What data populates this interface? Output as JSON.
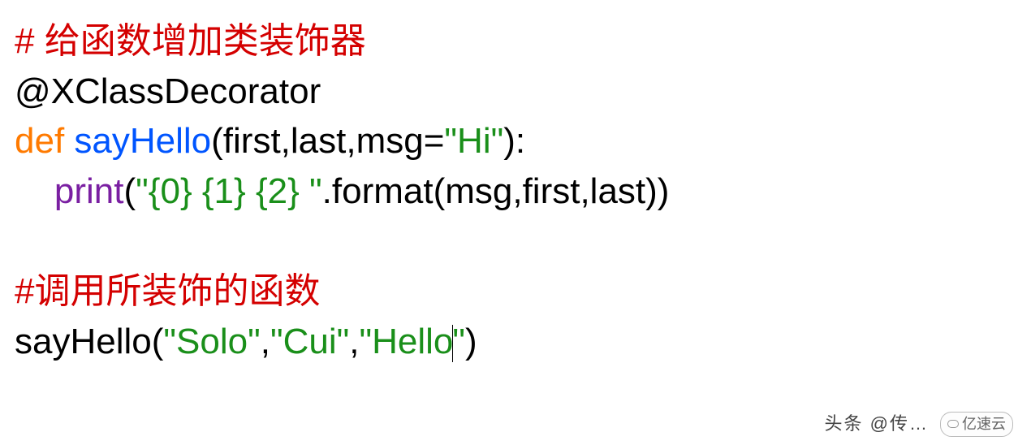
{
  "line1": {
    "comment": "# 给函数增加类装饰器"
  },
  "line2": {
    "decorator": "@XClassDecorator"
  },
  "line3": {
    "keyword": "def ",
    "func": "sayHello",
    "sig_open": "(first,last,msg=",
    "default_str": "\"Hi\"",
    "sig_close": "):"
  },
  "line4": {
    "indent": "    ",
    "print_name": "print",
    "open": "(",
    "fmt_str": "\"{0} {1} {2} \"",
    "dot_format": ".format(msg,first,last))"
  },
  "line6": {
    "comment": "#调用所装饰的函数"
  },
  "line7": {
    "call_name": "sayHello",
    "open": "(",
    "arg1": "\"Solo\"",
    "comma1": ",",
    "arg2": "\"Cui\"",
    "comma2": ",",
    "arg3a": "\"Hello",
    "arg3b": "\"",
    "close": ")"
  },
  "watermark": {
    "left": "头条 @传…",
    "badge": "亿速云"
  }
}
